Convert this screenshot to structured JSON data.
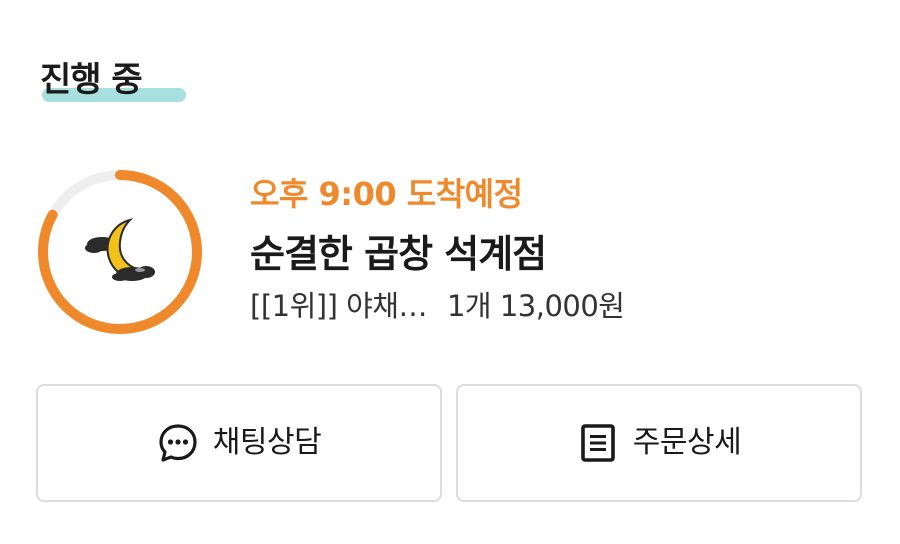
{
  "section": {
    "title": "진행 중"
  },
  "order": {
    "eta": "오후 9:00 도착예정",
    "store_name": "순결한 곱창 석계점",
    "item_name": "[[1위]] 야채…",
    "quantity": "1개",
    "price": "13,000원",
    "progress_fraction": 0.83,
    "logo_icon": "crescent-moon-cloud-logo"
  },
  "actions": {
    "chat_label": "채팅상담",
    "chat_icon": "chat-bubble-icon",
    "detail_label": "주문상세",
    "detail_icon": "document-icon"
  },
  "colors": {
    "accent": "#f0892b",
    "section_highlight": "#a7e0df",
    "ring_track": "#eeeeee",
    "border": "#dcdcdc"
  }
}
